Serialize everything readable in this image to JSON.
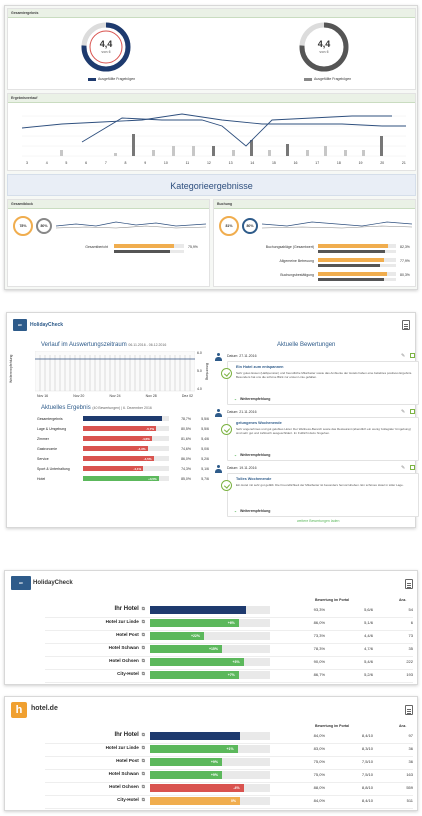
{
  "top": {
    "gesamt_title": "Gesamtergebnis",
    "gauge1": {
      "value": "4,4",
      "sub": "von 6"
    },
    "gauge2": {
      "value": "4,4",
      "sub": "von 6"
    },
    "legend1": "Ausgefüllte Fragebögen",
    "legend2": "Ausgefüllte Fragebögen",
    "verlauf_title": "Ergebnisverlauf",
    "xticks": [
      "3",
      "4",
      "5",
      "6",
      "7",
      "8",
      "9",
      "10",
      "11",
      "12",
      "13",
      "14",
      "15",
      "16",
      "17",
      "18",
      "19",
      "20",
      "21"
    ],
    "kategorie_title": "Kategorieergebnisse",
    "gesamtblock_title": "Gesamtblock",
    "buchung_title": "Buchung",
    "ring1": "78%",
    "ring2": "80%",
    "ring3": "81%",
    "ring4": "80%",
    "gesamt_row_label": "Gesamtbericht",
    "gesamt_row_val": "75,9%",
    "buchung_rows": [
      {
        "label": "Buchungsabläge (Gesamtwert)",
        "val": "82,3%"
      },
      {
        "label": "Allgemeine Betreuung",
        "val": "77,9%"
      },
      {
        "label": "Buchungsbestätigung",
        "val": "80,3%"
      }
    ]
  },
  "middle": {
    "logo_text": "HolidayCheck",
    "verlauf_title": "Verlauf im Auswertungszeitraum",
    "verlauf_range": "06.11.2016 - 06.12.2016",
    "y_left_label": "Weiterempfehlung",
    "y_right_label": "Bewertung",
    "chart_ticks": [
      "Nov 16",
      "Nov 20",
      "Nov 24",
      "Nov 28",
      "Dez 02"
    ],
    "y_right_ticks": [
      "6.0",
      "5.0",
      "4.0"
    ],
    "aktuell_title": "Aktuelles Ergebnis",
    "aktuell_sub": "(40 Bewertungen) | 6. Dezember 2016",
    "aktuell_rows": [
      {
        "label": "Gesamtergebnis",
        "val1": "78,7%",
        "val2": "5,5/6"
      },
      {
        "label": "Lage & Umgebung",
        "tag": "-5,7%",
        "val1": "80,5%",
        "val2": "5,5/6"
      },
      {
        "label": "Zimmer",
        "tag": "-4,6%",
        "val1": "81,6%",
        "val2": "5,4/6"
      },
      {
        "label": "Gastronomie",
        "tag": "-4,3%",
        "val1": "74,6%",
        "val2": "5,0/6"
      },
      {
        "label": "Service",
        "tag": "-4,5%",
        "val1": "86,0%",
        "val2": "5,2/6"
      },
      {
        "label": "Sport & Unterhaltung",
        "tag": "-4,1%",
        "val1": "74,3%",
        "val2": "5,1/6"
      },
      {
        "label": "Hotel",
        "tag": "+3,5%",
        "val1": "85,0%",
        "val2": "5,7/6"
      }
    ],
    "bewertungen_title": "Aktuelle Bewertungen",
    "reviews": [
      {
        "date": "Datum: 27.11.2016",
        "title": "Ein Hotel zum entspannen",
        "text": "Sehr gutes Essen (Halbpension) und freundliche Mitarbeiter sowie das Ambiente der Hotels haben eine beliebtes positives Ergebnis. Besonders hat uns die schöne Blick zur ersten Linie gefallen.",
        "rec": "Weiterempfehlung"
      },
      {
        "date": "Datum: 21.11.2016",
        "title": "gelungenes Wochenende",
        "text": "Sehr angenehmes und gut gelobtes Hotel. Der Wellness-Bereich sowie das Restaurant (abendlich ein wenig 'kollegiale' Umgebung) sind sehr gut und zahlreich ausgeschildert. Im Fußlicht dazu hingehen.",
        "rec": "Weiterempfehlung"
      },
      {
        "date": "Datum: 19.11.2016",
        "title": "Tolles Wochenende",
        "text": "Ein Hotel mit sehr gut gefällt. Die Freundlichkeit der Mitarbeiter ist besonders hervorzuheben. Ein schönes Hotel in toller Lage.",
        "rec": "Weiterempfehlung"
      }
    ],
    "more_link": "weitere Bewertungen laden"
  },
  "hc_table": {
    "logo_text": "HolidayCheck",
    "col_header": "Bewertung im Portal",
    "col_anz": "Anz.",
    "rows": [
      {
        "name": "Ihr Hotel",
        "tag": "",
        "pct": "93,3%",
        "score": "5,6/6",
        "anz": "54",
        "fill": 0.8,
        "color": "#1e3a6e",
        "highlight": true
      },
      {
        "name": "Hotel zur Linde",
        "tag": "+6%",
        "pct": "86,0%",
        "score": "5,1/6",
        "anz": "6",
        "fill": 0.74,
        "color": "#5cb85c"
      },
      {
        "name": "Hotel Post",
        "tag": "+22%",
        "pct": "73,3%",
        "score": "4,4/6",
        "anz": "73",
        "fill": 0.45,
        "color": "#5cb85c"
      },
      {
        "name": "Hotel Schwan",
        "tag": "+15%",
        "pct": "78,3%",
        "score": "4,7/6",
        "anz": "35",
        "fill": 0.6,
        "color": "#5cb85c"
      },
      {
        "name": "Hotel Ochsen",
        "tag": "+3%",
        "pct": "90,0%",
        "score": "5,4/6",
        "anz": "222",
        "fill": 0.78,
        "color": "#5cb85c"
      },
      {
        "name": "City-Hotel",
        "tag": "+7%",
        "pct": "86,7%",
        "score": "5,2/6",
        "anz": "193",
        "fill": 0.74,
        "color": "#5cb85c"
      }
    ]
  },
  "hd_table": {
    "logo_letter": "h",
    "logo_text": "hotel.de",
    "col_header": "Bewertung im Portal",
    "col_anz": "Anz.",
    "rows": [
      {
        "name": "Ihr Hotel",
        "tag": "",
        "pct": "84,0%",
        "score": "8,4/10",
        "anz": "97",
        "fill": 0.75,
        "color": "#1e3a6e",
        "highlight": true
      },
      {
        "name": "Hotel zur Linde",
        "tag": "+1%",
        "pct": "83,0%",
        "score": "8,3/10",
        "anz": "36",
        "fill": 0.73,
        "color": "#5cb85c"
      },
      {
        "name": "Hotel Post",
        "tag": "+9%",
        "pct": "75,0%",
        "score": "7,5/10",
        "anz": "36",
        "fill": 0.6,
        "color": "#5cb85c"
      },
      {
        "name": "Hotel Schwan",
        "tag": "+9%",
        "pct": "75,0%",
        "score": "7,5/10",
        "anz": "163",
        "fill": 0.6,
        "color": "#5cb85c"
      },
      {
        "name": "Hotel Ochsen",
        "tag": "-4%",
        "pct": "88,0%",
        "score": "8,8/10",
        "anz": "559",
        "fill": 0.78,
        "color": "#d9534f"
      },
      {
        "name": "City-Hotel",
        "tag": "0%",
        "pct": "84,0%",
        "score": "8,4/10",
        "anz": "511",
        "fill": 0.75,
        "color": "#f0ad4e"
      }
    ]
  }
}
